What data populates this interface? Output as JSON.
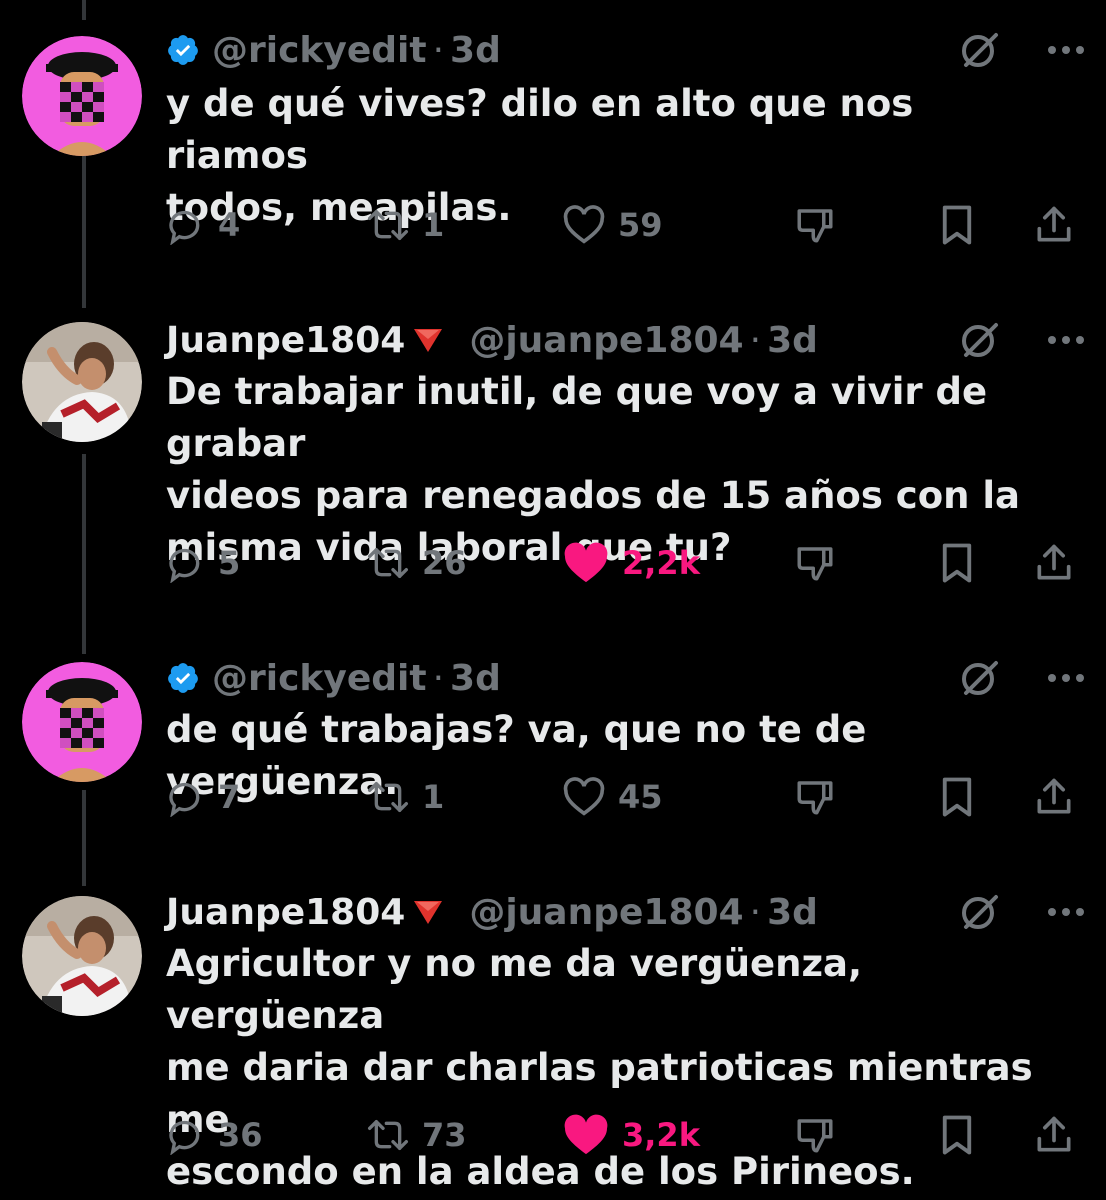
{
  "colors": {
    "background": "#000000",
    "text": "#e7e9ea",
    "muted": "#71767b",
    "like_active": "#f91880",
    "verified_blue": "#1d9bf0",
    "thread_line": "#333639"
  },
  "icons": {
    "verified": "verified-badge-icon",
    "red_triangle": "red-triangle-icon",
    "grok": "grok-icon",
    "more": "more-icon",
    "reply": "reply-icon",
    "repost": "repost-icon",
    "like": "heart-icon",
    "downvote": "downvote-icon",
    "bookmark": "bookmark-icon",
    "share": "share-icon"
  },
  "tweets": [
    {
      "display_name": "",
      "handle": "@rickyedit",
      "dot": "·",
      "time": "3d",
      "verified": true,
      "text": "y de qué vives? dilo en alto que nos riamos\ntodos, meapilas.",
      "replies": "4",
      "reposts": "1",
      "likes": "59",
      "liked": false
    },
    {
      "display_name": "Juanpe1804",
      "handle": "@juanpe1804",
      "dot": "·",
      "time": "3d",
      "verified": false,
      "text": "De trabajar inutil, de que voy a vivir de grabar\nvideos para renegados de 15 años con la\nmisma vida laboral que tu?",
      "replies": "5",
      "reposts": "26",
      "likes": "2,2k",
      "liked": true
    },
    {
      "display_name": "",
      "handle": "@rickyedit",
      "dot": "·",
      "time": "3d",
      "verified": true,
      "text": "de qué trabajas? va, que no te de vergüenza.",
      "replies": "7",
      "reposts": "1",
      "likes": "45",
      "liked": false
    },
    {
      "display_name": "Juanpe1804",
      "handle": "@juanpe1804",
      "dot": "·",
      "time": "3d",
      "verified": false,
      "text": "Agricultor y no me da vergüenza, vergüenza\nme daria dar charlas patrioticas mientras me\nescondo en la aldea de los Pirineos.",
      "replies": "36",
      "reposts": "73",
      "likes": "3,2k",
      "liked": true
    }
  ]
}
